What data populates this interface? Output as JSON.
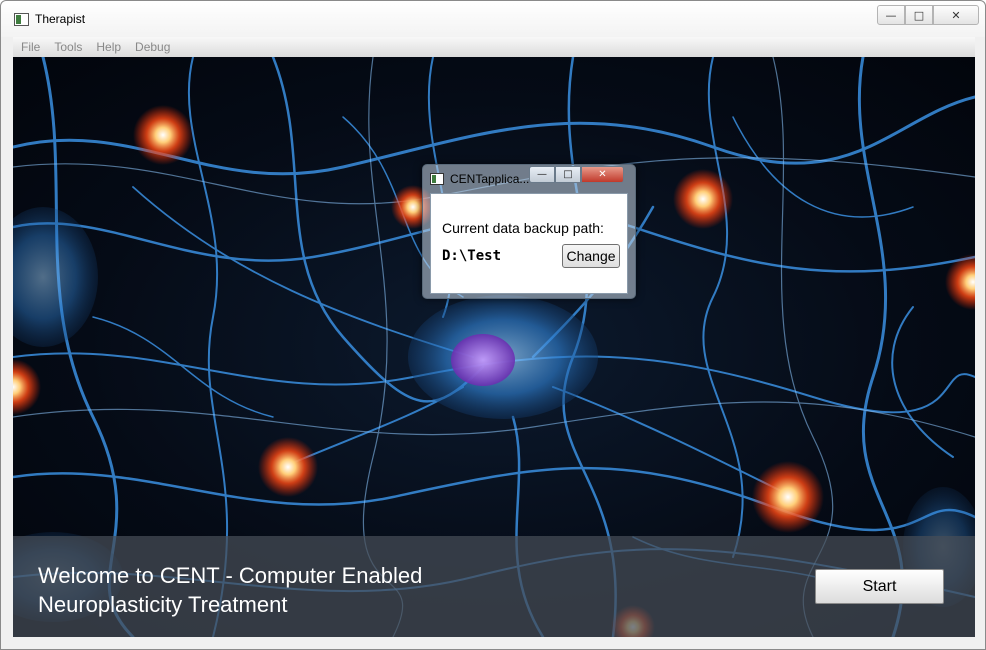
{
  "window": {
    "title": "Therapist",
    "caption": {
      "minimize": "—",
      "maximize": "□",
      "close": "✕"
    }
  },
  "menu": {
    "items": [
      "File",
      "Tools",
      "Help",
      "Debug"
    ]
  },
  "banner": {
    "welcome_line1": "Welcome to CENT - Computer Enabled",
    "welcome_line2": "Neuroplasticity Treatment",
    "start_label": "Start"
  },
  "dialog": {
    "title": "CENTapplica...",
    "caption": {
      "minimize": "—",
      "maximize": "□",
      "close": "✕"
    },
    "label": "Current data backup path:",
    "path": "D:\\Test",
    "change_label": "Change"
  },
  "colors": {
    "neuron_blue": "#3a8fe0",
    "neuron_glow": "#ff5a1a",
    "nucleus": "#8a4fd0"
  }
}
